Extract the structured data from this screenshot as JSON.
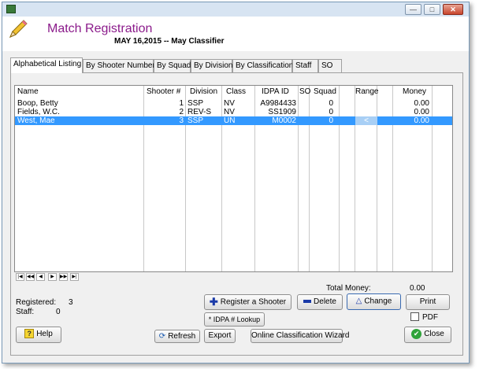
{
  "window": {
    "minimize": "—",
    "maximize": "□",
    "close": "✕"
  },
  "header": {
    "title": "Match Registration",
    "subtitle": "MAY 16,2015 -- May Classifier"
  },
  "tabs": [
    "Alphabetical Listing",
    "By Shooter Number",
    "By Squad",
    "By Division",
    "By Classification",
    "Staff",
    "SO"
  ],
  "grid": {
    "headers": [
      "Name",
      "Shooter #",
      "Division",
      "Class",
      "IDPA ID",
      "SO",
      "Squad",
      "Range",
      "Money"
    ],
    "rows": [
      {
        "name": "Boop, Betty",
        "num": "1",
        "div": "SSP",
        "cls": "NV",
        "id": "A9984433",
        "so": "",
        "squad": "0",
        "range": "",
        "money": "0.00"
      },
      {
        "name": "Fields, W.C.",
        "num": "2",
        "div": "REV-S",
        "cls": "NV",
        "id": "SS1909",
        "so": "",
        "squad": "0",
        "range": "",
        "money": "0.00"
      },
      {
        "name": "West, Mae",
        "num": "3",
        "div": "SSP",
        "cls": "UN",
        "id": "M0002",
        "so": "",
        "squad": "0",
        "range": "<",
        "money": "0.00"
      }
    ]
  },
  "nav": [
    "|◀",
    "◀◀",
    "◀",
    "▶",
    "▶▶",
    "▶|"
  ],
  "totals": {
    "label": "Total Money:",
    "value": "0.00"
  },
  "stats": {
    "registered_label": "Registered:",
    "registered": "3",
    "staff_label": "Staff:",
    "staff": "0"
  },
  "buttons": {
    "register": "Register a Shooter",
    "delete": "Delete",
    "change": "Change",
    "print": "Print",
    "pdf": "PDF",
    "lookup": "* IDPA # Lookup",
    "help": "Help",
    "refresh": "Refresh",
    "export": "Export",
    "wizard": "Online Classification Wizard",
    "close": "Close"
  },
  "colors": {
    "title": "#8b1b8b",
    "selection": "#3399ff"
  }
}
